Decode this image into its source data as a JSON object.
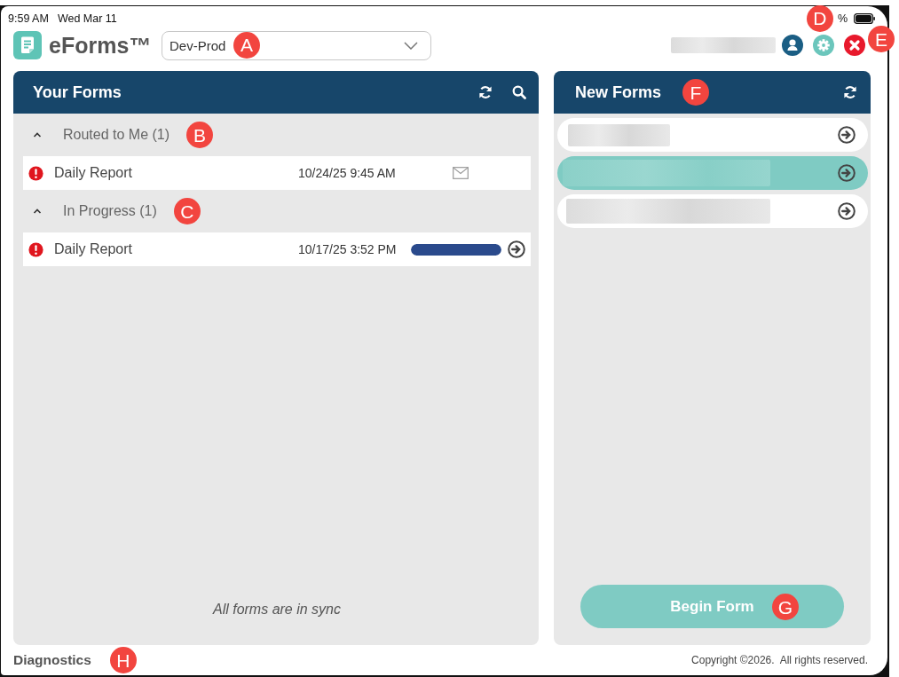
{
  "status_bar": {
    "time": "9:59 AM",
    "date": "Wed Mar 11",
    "callout": "D",
    "battery": "%"
  },
  "header": {
    "app_name": "eForms™",
    "environment": {
      "value": "Dev-Prod",
      "callout": "A"
    },
    "close_callout": "E"
  },
  "your_forms": {
    "title": "Your Forms",
    "groups": [
      {
        "title": "Routed to Me (1)",
        "expanded": true,
        "callout": "B",
        "rows": [
          {
            "kind": "routed",
            "alert": true,
            "name": "Daily Report",
            "date": "10/24/25 9:45 AM"
          }
        ]
      },
      {
        "title": "In Progress (1)",
        "expanded": true,
        "callout": "C",
        "rows": [
          {
            "kind": "progress",
            "alert": true,
            "name": "Daily Report",
            "date": "10/17/25 3:52 PM",
            "level": 1
          }
        ]
      }
    ],
    "sync_status": "All forms are in sync"
  },
  "new_forms": {
    "title": "New Forms",
    "callout": "F",
    "items": [
      {
        "selected": false
      },
      {
        "selected": true
      },
      {
        "selected": false
      }
    ],
    "begin_button": {
      "label": "Begin Form",
      "callout": "G"
    }
  },
  "footer": {
    "diagnostics": "Diagnostics",
    "callout": "H",
    "copyright": "Copyright ©2026.  All rights reserved."
  }
}
